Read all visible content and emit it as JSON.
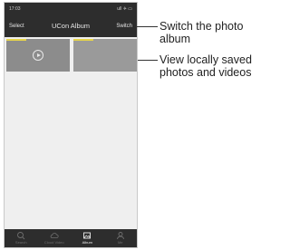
{
  "status": {
    "time": "17:03",
    "icons": "ull ✈ ▭"
  },
  "header": {
    "select_label": "Select",
    "title": "UCon Album",
    "switch_label": "Switch"
  },
  "album": {
    "items": [
      {
        "type": "video"
      },
      {
        "type": "photo"
      }
    ]
  },
  "tabs": [
    {
      "label": "Search",
      "icon": "search-icon",
      "active": false
    },
    {
      "label": "Cloud Video",
      "icon": "cloud-icon",
      "active": false
    },
    {
      "label": "Album",
      "icon": "album-icon",
      "active": true
    },
    {
      "label": "Me",
      "icon": "person-icon",
      "active": false
    }
  ],
  "annotations": {
    "switch": [
      "Switch the photo",
      "album"
    ],
    "view": [
      "View locally saved",
      "photos and videos"
    ]
  },
  "colors": {
    "bar": "#2d2d2d",
    "accent": "#e6d44a"
  }
}
